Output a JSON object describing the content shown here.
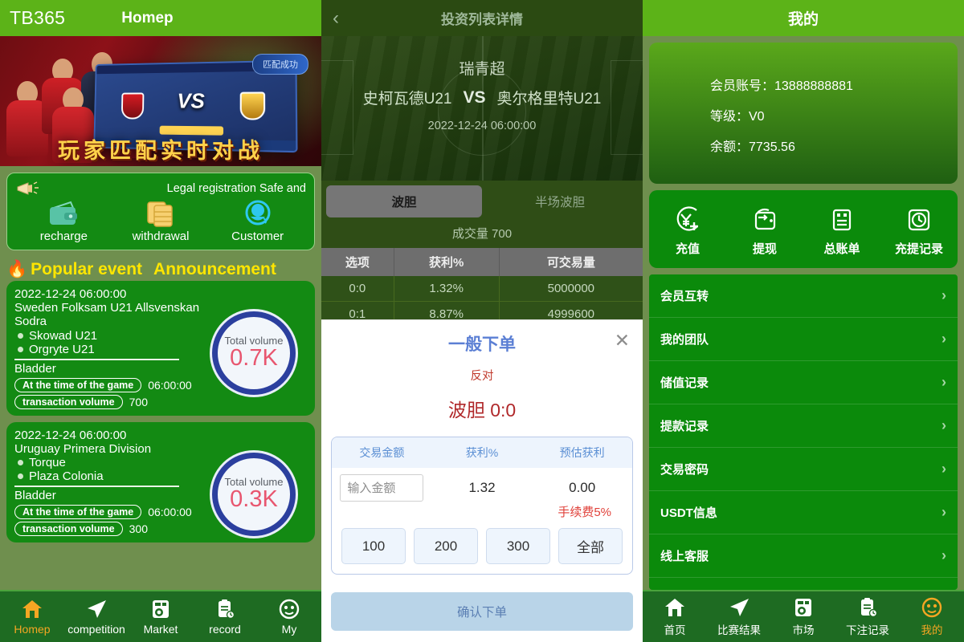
{
  "left": {
    "header": {
      "logo": "TB365",
      "title": "Homep"
    },
    "banner": {
      "badge": "匹配成功",
      "slogan": "玩家匹配实时对战",
      "vs": "VS"
    },
    "promo": {
      "marquee": "Legal registration Safe and",
      "items": [
        {
          "label": "recharge",
          "icon": "wallet-icon"
        },
        {
          "label": "withdrawal",
          "icon": "cards-icon"
        },
        {
          "label": "Customer",
          "icon": "headset-icon"
        }
      ]
    },
    "section": {
      "fire": "🔥",
      "title": "Popular event",
      "title2": "Announcement"
    },
    "events": [
      {
        "time": "2022-12-24 06:00:00",
        "league": "Sweden Folksam U21 Allsvenskan Sodra",
        "team_home": "Skowad U21",
        "team_away": "Orgryte U21",
        "market": "Bladder",
        "pill_time_label": "At the time of the game",
        "pill_time_value": "06:00:00",
        "pill_vol_label": "transaction volume",
        "pill_vol_value": "700",
        "badge_label": "Total volume",
        "badge_value": "0.7K"
      },
      {
        "time": "2022-12-24 06:00:00",
        "league": "Uruguay Primera Division",
        "team_home": "Torque",
        "team_away": "Plaza Colonia",
        "market": "Bladder",
        "pill_time_label": "At the time of the game",
        "pill_time_value": "06:00:00",
        "pill_vol_label": "transaction volume",
        "pill_vol_value": "300",
        "badge_label": "Total volume",
        "badge_value": "0.3K"
      }
    ],
    "tabbar": [
      {
        "label": "Homep",
        "icon": "home-icon",
        "active": true
      },
      {
        "label": "competition",
        "icon": "paperplane-icon",
        "active": false
      },
      {
        "label": "Market",
        "icon": "market-icon",
        "active": false
      },
      {
        "label": "record",
        "icon": "clipboard-clock-icon",
        "active": false
      },
      {
        "label": "My",
        "icon": "face-icon",
        "active": false
      }
    ]
  },
  "mid": {
    "header": {
      "back": "‹",
      "title": "投资列表详情"
    },
    "match": {
      "league": "瑞青超",
      "home": "史柯瓦德U21",
      "vs": "VS",
      "away": "奥尔格里特U21",
      "date": "2022-12-24 06:00:00"
    },
    "tabs": [
      {
        "label": "波胆",
        "active": true
      },
      {
        "label": "半场波胆",
        "active": false
      }
    ],
    "volume_text": "成交量 700",
    "table": {
      "headers": [
        "选项",
        "获利%",
        "可交易量"
      ],
      "rows": [
        [
          "0:0",
          "1.32%",
          "5000000"
        ],
        [
          "0:1",
          "8.87%",
          "4999600"
        ]
      ]
    },
    "modal": {
      "title": "一般下单",
      "close": "✕",
      "opposite": "反对",
      "score_label": "波胆 0:0",
      "col_headers": [
        "交易金额",
        "获利%",
        "预估获利"
      ],
      "amount_placeholder": "输入金额",
      "amount_value": "",
      "profit_pct": "1.32",
      "est_profit": "0.00",
      "fee_text": "手续费5%",
      "quick": [
        "100",
        "200",
        "300",
        "全部"
      ],
      "submit": "确认下单"
    }
  },
  "right": {
    "header": {
      "title": "我的"
    },
    "account": {
      "account_line": "会员账号：13888888881",
      "level_line": "等级：V0",
      "balance_line": "余额：7735.56"
    },
    "quick": [
      {
        "label": "充值",
        "icon": "yen-plus-icon"
      },
      {
        "label": "提现",
        "icon": "wallet-out-icon"
      },
      {
        "label": "总账单",
        "icon": "bill-icon"
      },
      {
        "label": "充提记录",
        "icon": "clock-square-icon"
      }
    ],
    "menu": [
      {
        "label": "会员互转",
        "chev": "›"
      },
      {
        "label": "我的团队",
        "chev": "›"
      },
      {
        "label": "储值记录",
        "chev": "›"
      },
      {
        "label": "提款记录",
        "chev": "›"
      },
      {
        "label": "交易密码",
        "chev": "›"
      },
      {
        "label": "USDT信息",
        "chev": "›"
      },
      {
        "label": "线上客服",
        "chev": "›"
      }
    ],
    "tabbar": [
      {
        "label": "首页",
        "icon": "home-icon",
        "active": false
      },
      {
        "label": "比赛结果",
        "icon": "paperplane-icon",
        "active": false
      },
      {
        "label": "市场",
        "icon": "market-icon",
        "active": false
      },
      {
        "label": "下注记录",
        "icon": "clipboard-clock-icon",
        "active": false
      },
      {
        "label": "我的",
        "icon": "face-icon",
        "active": true
      }
    ]
  },
  "colors": {
    "brand_green": "#5cb318",
    "panel_bg": "#6f8f4e",
    "card_green": "#138a13",
    "tabbar_green": "#1e6b22",
    "accent_orange": "#f5a623",
    "accent_yellow": "#ffe600",
    "modal_blue": "#5b7fd4",
    "modal_red": "#b0282a",
    "badge_blue": "#2b3f9e",
    "badge_pink": "#e8566f"
  }
}
